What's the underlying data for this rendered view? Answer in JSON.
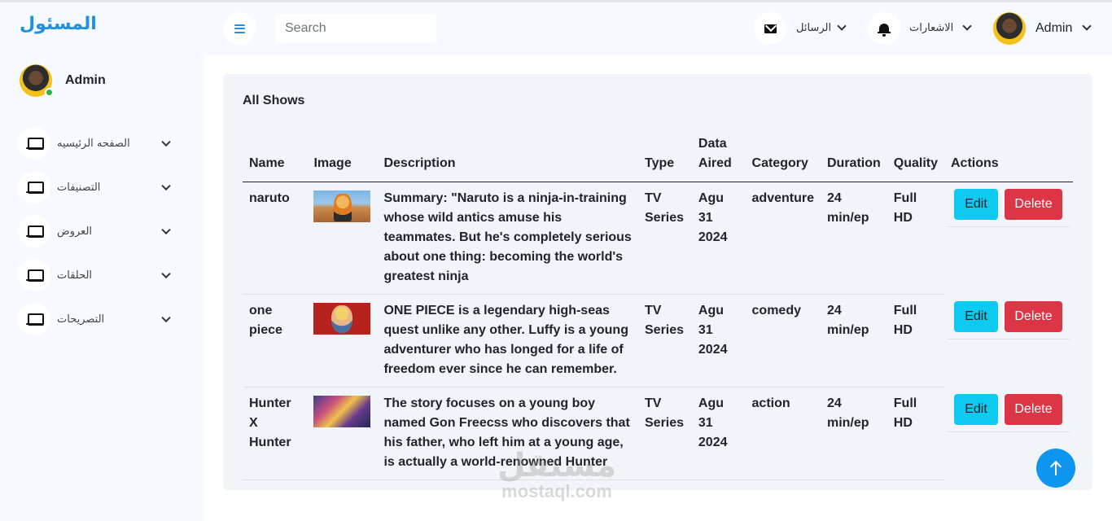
{
  "brand": "المسئول",
  "sidebar": {
    "profile_name": "Admin",
    "items": [
      {
        "label": "الصفحه الرئيسيه",
        "icon": "laptop-icon"
      },
      {
        "label": "التصنيفات",
        "icon": "laptop-icon"
      },
      {
        "label": "العروض",
        "icon": "laptop-icon"
      },
      {
        "label": "الحلقات",
        "icon": "laptop-icon"
      },
      {
        "label": "التصريحات",
        "icon": "laptop-icon"
      }
    ]
  },
  "header": {
    "search_placeholder": "Search",
    "messages_label": "الرسائل",
    "notifications_label": "الاشعارات",
    "user_name": "Admin"
  },
  "main": {
    "title": "All Shows",
    "columns": [
      "Name",
      "Image",
      "Description",
      "Type",
      "Data Aired",
      "Category",
      "Duration",
      "Quality",
      "Actions"
    ],
    "rows": [
      {
        "name": "naruto",
        "description": "Summary: \"Naruto is a ninja-in-training whose wild antics amuse his teammates. But he's completely serious about one thing: becoming the world's greatest ninja",
        "type": "TV Series",
        "date_aired": "Agu 31 2024",
        "category": "adventure",
        "duration": "24 min/ep",
        "quality": "Full HD",
        "edit_label": "Edit",
        "delete_label": "Delete"
      },
      {
        "name": "one piece",
        "description": "ONE PIECE is a legendary high-seas quest unlike any other. Luffy is a young adventurer who has longed for a life of freedom ever since he can remember.",
        "type": "TV Series",
        "date_aired": "Agu 31 2024",
        "category": "comedy",
        "duration": "24 min/ep",
        "quality": "Full HD",
        "edit_label": "Edit",
        "delete_label": "Delete"
      },
      {
        "name": "Hunter X Hunter",
        "description": "The story focuses on a young boy named Gon Freecss who discovers that his father, who left him at a young age, is actually a world-renowned Hunter",
        "type": "TV Series",
        "date_aired": "Agu 31 2024",
        "category": "action",
        "duration": "24 min/ep",
        "quality": "Full HD",
        "edit_label": "Edit",
        "delete_label": "Delete"
      }
    ]
  },
  "watermark": {
    "arabic": "مستقل",
    "latin": "mostaql.com"
  },
  "colors": {
    "brand": "#1e90e8",
    "edit": "#0dcaf0",
    "delete": "#dc3545",
    "scroll_top": "#0d95f0"
  }
}
